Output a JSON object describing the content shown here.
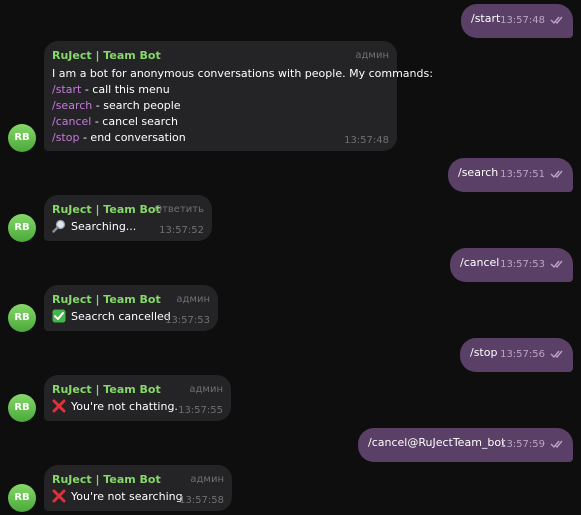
{
  "colors": {
    "background": "#0e0e0f",
    "outgoing_bubble": "#5a3f66",
    "incoming_bubble": "#242426",
    "sender_name": "#86d86a",
    "command_link": "#c678dd"
  },
  "messages": [
    {
      "dir": "out",
      "text": "/start",
      "time": "13:57:48",
      "status_icon": "double-check-icon"
    },
    {
      "dir": "in",
      "avatar": "RB",
      "sender": "RuJect | Team Bot",
      "tag": "админ",
      "intro": "I am a bot for anonymous conversations with people. My commands:",
      "commands": [
        {
          "cmd": "/start",
          "desc": " - call this menu"
        },
        {
          "cmd": "/search",
          "desc": " - search people"
        },
        {
          "cmd": "/cancel",
          "desc": " - cancel search"
        },
        {
          "cmd": "/stop",
          "desc": " - end conversation"
        }
      ],
      "time": "13:57:48"
    },
    {
      "dir": "out",
      "text": "/search",
      "time": "13:57:51",
      "status_icon": "double-check-icon"
    },
    {
      "dir": "in",
      "avatar": "RB",
      "sender": "RuJect | Team Bot",
      "tag": "Ответить",
      "icon": "magnifier-emoji-icon",
      "text": "Searching...",
      "time": "13:57:52"
    },
    {
      "dir": "out",
      "text": "/cancel",
      "time": "13:57:53",
      "status_icon": "double-check-icon"
    },
    {
      "dir": "in",
      "avatar": "RB",
      "sender": "RuJect | Team Bot",
      "tag": "админ",
      "icon": "check-mark-emoji-icon",
      "text": "Seacrch cancelled",
      "time": "13:57:53"
    },
    {
      "dir": "out",
      "text": "/stop",
      "time": "13:57:56",
      "status_icon": "double-check-icon"
    },
    {
      "dir": "in",
      "avatar": "RB",
      "sender": "RuJect | Team Bot",
      "tag": "админ",
      "icon": "cross-mark-emoji-icon",
      "text": "You're not chatting.",
      "time": "13:57:55"
    },
    {
      "dir": "out",
      "text": "/cancel@RuJectTeam_bot",
      "time": "13:57:59",
      "status_icon": "double-check-icon"
    },
    {
      "dir": "in",
      "avatar": "RB",
      "sender": "RuJect | Team Bot",
      "tag": "админ",
      "icon": "cross-mark-emoji-icon",
      "text": "You're not searching",
      "time": "13:57:58"
    }
  ]
}
